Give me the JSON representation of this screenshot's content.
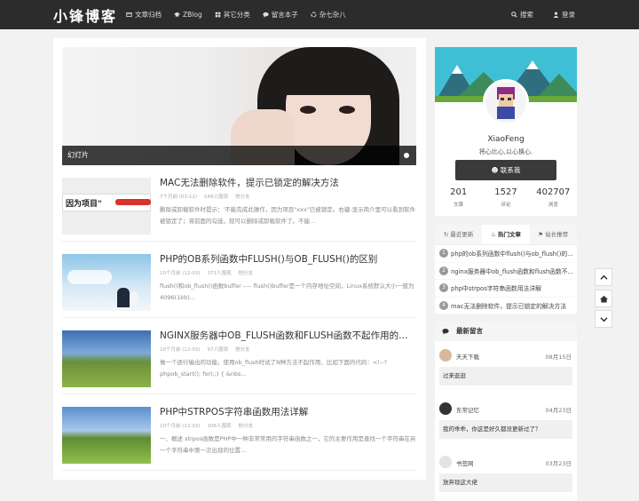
{
  "header": {
    "logo": "小锋博客",
    "nav": [
      {
        "label": "文章归档",
        "icon": "archive-icon"
      },
      {
        "label": "ZBlog",
        "icon": "graduation-cap-icon"
      },
      {
        "label": "其它分类",
        "icon": "apps-icon"
      },
      {
        "label": "留言本子",
        "icon": "comments-icon"
      },
      {
        "label": "杂七杂八",
        "icon": "recycle-icon"
      }
    ],
    "search_label": "搜索",
    "login_label": "登录"
  },
  "slider": {
    "caption": "幻灯片"
  },
  "posts": [
    {
      "title": "MAC无法删除软件，提示已锁定的解决方法",
      "date": "7个月前 (03-12)",
      "views": "548人围观",
      "tag": "他分支",
      "excerpt": "删除或卸载软件时提示：'不能完成此操作，因为项目\"xxx\"已被锁定。右键-显示简介里可以看到软件被锁定了；将前面的勾选，就可以删除或卸载软件了。不能...",
      "thumb_text": "因为项目\""
    },
    {
      "title": "PHP的OB系列函数中FLUSH()与OB_FLUSH()的区别",
      "date": "10个月前 (12-03)",
      "views": "371人围观",
      "tag": "他分支",
      "excerpt": "flush()和ob_flush()函数buffer ---- flush()buffer是一个内存地址空间，Linux系统默认大小一般为4096(1kb)..."
    },
    {
      "title": "NGINX服务器中OB_FLUSH函数和FLUSH函数不起作用的解决方法",
      "date": "10个月前 (12-03)",
      "views": "97人围观",
      "tag": "他分支",
      "excerpt": "做一个逐行输出的功能，使用ob_flush时试了N种方法不起作用，比如下面的代码：<!--?phpob_start(); for(;;) { &nbs..."
    },
    {
      "title": "PHP中STRPOS字符串函数用法详解",
      "date": "10个月前 (12-03)",
      "views": "106人围观",
      "tag": "他分支",
      "excerpt": "一、概述 strpos函数是PHP中一种非常常用的字符串函数之一，它的主要作用是查找一个字符串在另一个字符串中第一次出现的位置..."
    }
  ],
  "profile": {
    "name": "XiaoFeng",
    "motto": "将心比心,以心换心.",
    "contact_label": "联系我",
    "stats": [
      {
        "value": "201",
        "label": "文章"
      },
      {
        "value": "1527",
        "label": "评论"
      },
      {
        "value": "402707",
        "label": "浏览"
      }
    ]
  },
  "tabs": [
    {
      "label": "最近更新",
      "icon": "refresh-icon"
    },
    {
      "label": "热门文章",
      "icon": "fire-icon"
    },
    {
      "label": "站长推荐",
      "icon": "flag-icon"
    }
  ],
  "hot_list": [
    {
      "num": "1",
      "title": "php的ob系列函数中flush()与ob_flush()的..."
    },
    {
      "num": "2",
      "title": "nginx服务器中ob_flush函数和flush函数不..."
    },
    {
      "num": "3",
      "title": "php中strpos字符串函数用法详解"
    },
    {
      "num": "4",
      "title": "mac无法删除软件，提示已锁定的解决方法"
    }
  ],
  "comments_title": "最新留言",
  "comments": [
    {
      "name": "天天下载",
      "date": "08月15日",
      "text": "过来逛逛"
    },
    {
      "name": "东常记忆",
      "date": "04月23日",
      "text": "我的乖乖，你这是好久都没更新过了？"
    },
    {
      "name": "书签网",
      "date": "03月23日",
      "text": "放弃现这大佬"
    }
  ],
  "colors": {
    "topbar": "#2c2c2c",
    "banner": "#3fbfd6",
    "button": "#3a3a3a"
  }
}
